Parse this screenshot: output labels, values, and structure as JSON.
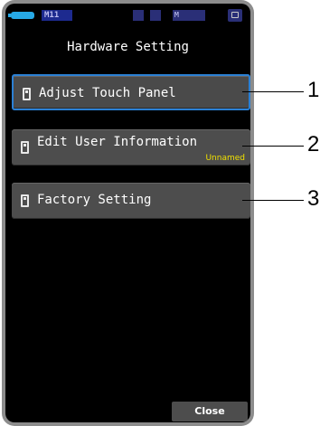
{
  "status": {
    "memory_badge": "M11",
    "mode_icon": "M",
    "battery_color": "#27a9e6"
  },
  "screen": {
    "title": "Hardware Setting",
    "menu": [
      {
        "label": "Adjust Touch Panel",
        "selected": true
      },
      {
        "label": "Edit User Information",
        "sublabel": "Unnamed",
        "selected": false
      },
      {
        "label": "Factory Setting",
        "selected": false
      }
    ],
    "close_label": "Close"
  },
  "callouts": [
    "1",
    "2",
    "3"
  ],
  "colors": {
    "accent": "#2b80d4",
    "sublabel": "#f0e000",
    "button": "#4d4d4d"
  }
}
